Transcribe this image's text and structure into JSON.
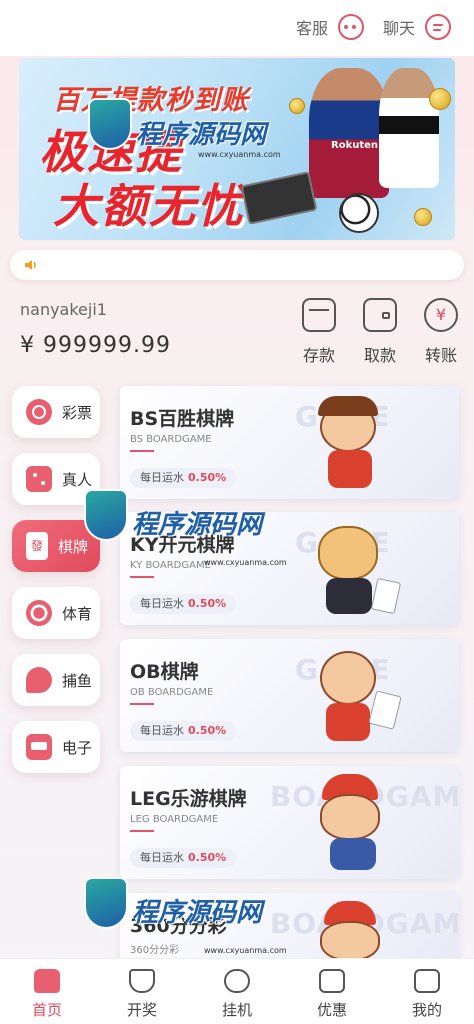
{
  "header": {
    "kefu_label": "客服",
    "chat_label": "聊天"
  },
  "banner": {
    "line1": "百万提款秒到账",
    "line2": "极速提",
    "line3": "大额无忧",
    "logo_text": "Rokuten"
  },
  "account": {
    "username": "nanyakeji1",
    "balance": "¥ 999999.99",
    "actions": [
      {
        "label": "存款",
        "icon": "card-icon"
      },
      {
        "label": "取款",
        "icon": "wallet-icon"
      },
      {
        "label": "转账",
        "icon": "yuan-transfer-icon"
      }
    ]
  },
  "sidebar": {
    "items": [
      {
        "label": "彩票",
        "icon": "lottery-icon",
        "active": false
      },
      {
        "label": "真人",
        "icon": "dice-icon",
        "active": false
      },
      {
        "label": "棋牌",
        "icon": "mahjong-icon",
        "active": true
      },
      {
        "label": "体育",
        "icon": "soccer-icon",
        "active": false
      },
      {
        "label": "捕鱼",
        "icon": "fish-icon",
        "active": false
      },
      {
        "label": "电子",
        "icon": "arcade-icon",
        "active": false
      }
    ]
  },
  "games": [
    {
      "title": "BS百胜棋牌",
      "subtitle": "BS BOARDGAME",
      "rebate_label": "每日运水",
      "rebate_value": "0.50%",
      "watermark": "GAME"
    },
    {
      "title": "KY开元棋牌",
      "subtitle": "KY BOARDGAME",
      "rebate_label": "每日运水",
      "rebate_value": "0.50%",
      "watermark": "GAME"
    },
    {
      "title": "OB棋牌",
      "subtitle": "OB BOARDGAME",
      "rebate_label": "每日运水",
      "rebate_value": "0.50%",
      "watermark": "GAME"
    },
    {
      "title": "LEG乐游棋牌",
      "subtitle": "LEG BOARDGAME",
      "rebate_label": "每日运水",
      "rebate_value": "0.50%",
      "watermark": "BOARDGAME"
    },
    {
      "title": "360分分彩",
      "subtitle": "360分分彩",
      "watermark": "BOARDGAME"
    }
  ],
  "watermark": {
    "text": "程序源码网",
    "url": "www.cxyuanma.com"
  },
  "bottom_nav": {
    "items": [
      {
        "label": "首页",
        "icon": "home-icon",
        "active": true
      },
      {
        "label": "开奖",
        "icon": "trophy-icon",
        "active": false
      },
      {
        "label": "挂机",
        "icon": "cloud-icon",
        "active": false
      },
      {
        "label": "优惠",
        "icon": "ticket-icon",
        "active": false
      },
      {
        "label": "我的",
        "icon": "profile-icon",
        "active": false
      }
    ]
  },
  "colors": {
    "accent": "#e04a5c",
    "accent_light": "#f06c7c",
    "background": "#f9eef0"
  }
}
